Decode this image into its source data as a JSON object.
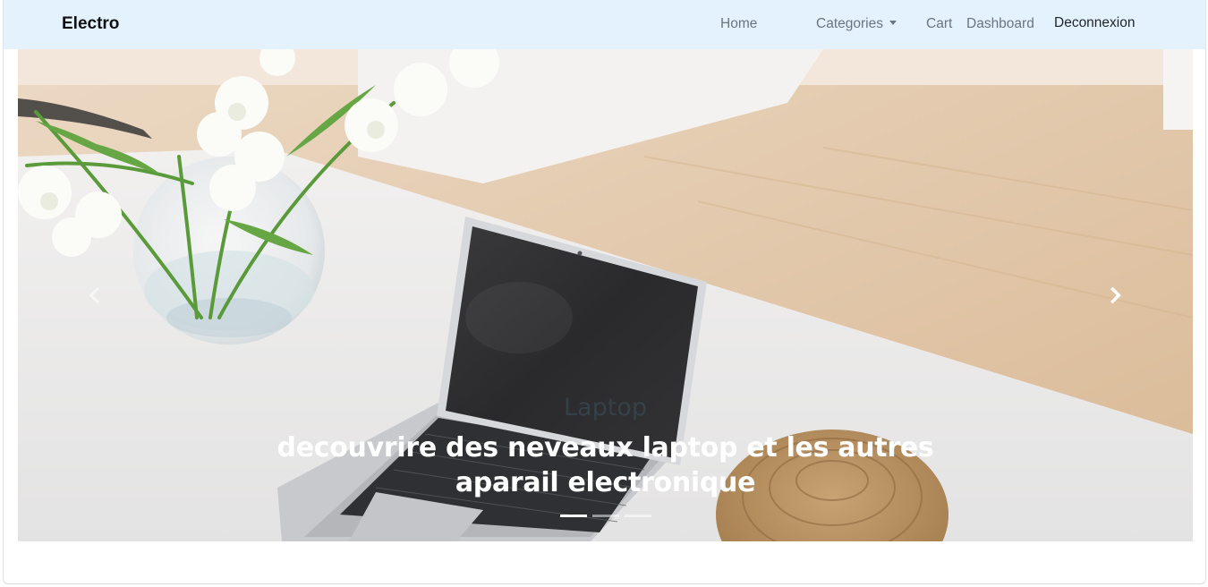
{
  "navbar": {
    "brand": "Electro",
    "links": {
      "home": "Home",
      "categories": "Categories",
      "cart": "Cart",
      "dashboard": "Dashboard",
      "logout": "Deconnexion"
    }
  },
  "carousel": {
    "active_slide": 0,
    "slide_count": 3,
    "caption_title": "Laptop",
    "caption_text": "decouvrire des neveaux laptop et les autres aparail electronique",
    "prev_icon": "chevron-left-icon",
    "next_icon": "chevron-right-icon"
  },
  "colors": {
    "navbar_bg": "#e3f2fd",
    "brand": "#111111",
    "nav_link": "#6c757d",
    "caption_text": "#ffffff"
  }
}
